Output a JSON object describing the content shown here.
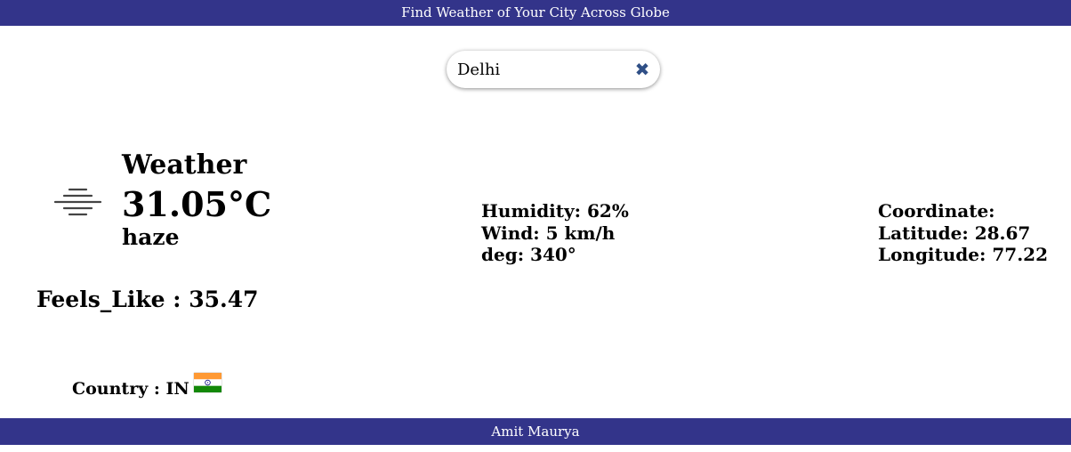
{
  "header": {
    "title": "Find Weather of Your City Across Globe"
  },
  "search": {
    "value": "Delhi",
    "clear_icon": "close-icon",
    "clear_glyph": "✖"
  },
  "weather": {
    "title": "Weather",
    "temperature": "31.05°C",
    "description": "haze",
    "icon": "haze-icon",
    "feels_like_label": "Feels_Like :",
    "feels_like_value": "35.47",
    "country_label": "Country :",
    "country_code": "IN"
  },
  "details": {
    "humidity": "Humidity: 62%",
    "wind": "Wind: 5 km/h",
    "deg": "deg: 340°"
  },
  "coordinates": {
    "title": "Coordinate:",
    "latitude": "Latitude: 28.67",
    "longitude": "Longitude: 77.22"
  },
  "footer": {
    "author": "Amit Maurya"
  },
  "colors": {
    "bar": "#33348a",
    "clear_icon": "#2f4f86"
  }
}
